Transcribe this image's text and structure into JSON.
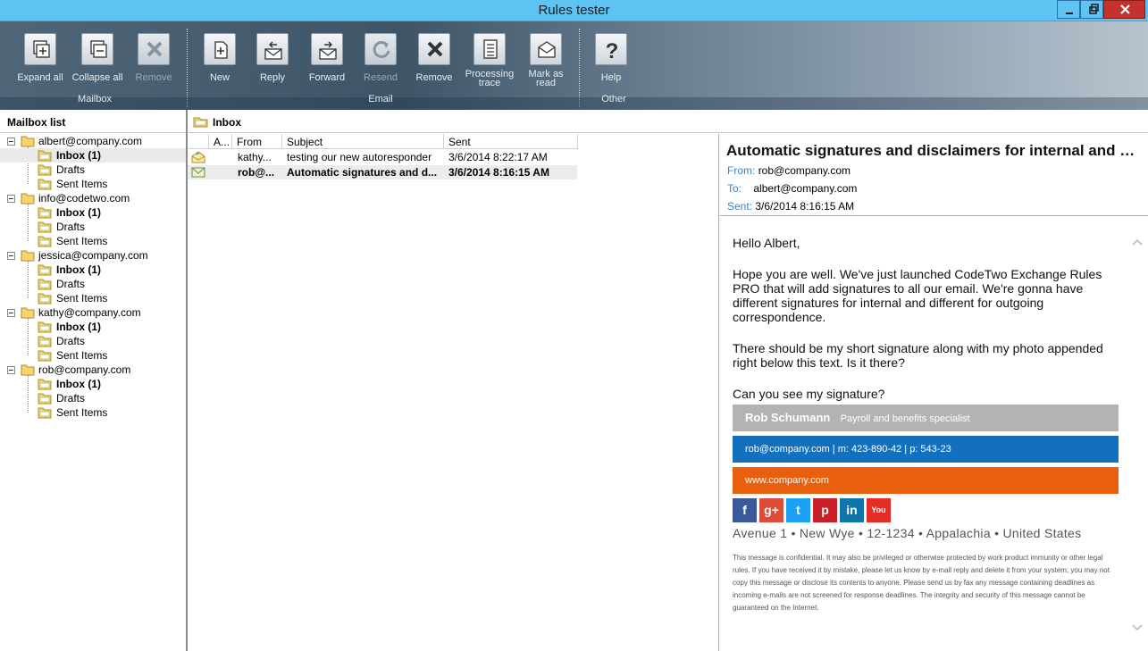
{
  "window": {
    "title": "Rules tester"
  },
  "ribbon": {
    "groups": [
      {
        "label": "Mailbox",
        "buttons": [
          {
            "label": "Expand all",
            "icon": "expand-all-icon",
            "enabled": true
          },
          {
            "label": "Collapse all",
            "icon": "collapse-all-icon",
            "enabled": true
          },
          {
            "label": "Remove",
            "icon": "remove-icon",
            "enabled": false
          }
        ]
      },
      {
        "label": "Email",
        "buttons": [
          {
            "label": "New",
            "icon": "new-email-icon",
            "enabled": true
          },
          {
            "label": "Reply",
            "icon": "reply-icon",
            "enabled": true
          },
          {
            "label": "Forward",
            "icon": "forward-icon",
            "enabled": true
          },
          {
            "label": "Resend",
            "icon": "resend-icon",
            "enabled": false
          },
          {
            "label": "Remove",
            "icon": "remove-icon",
            "enabled": true
          },
          {
            "label": "Processing trace",
            "label_lines": [
              "Processing",
              "trace"
            ],
            "icon": "processing-trace-icon",
            "enabled": true
          },
          {
            "label": "Mark as read",
            "label_lines": [
              "Mark as",
              "read"
            ],
            "icon": "mark-read-icon",
            "enabled": true
          }
        ]
      },
      {
        "label": "Other",
        "buttons": [
          {
            "label": "Help",
            "icon": "help-icon",
            "enabled": true
          }
        ]
      }
    ]
  },
  "mailbox_list": {
    "header": "Mailbox list",
    "accounts": [
      {
        "name": "albert@company.com",
        "folders": [
          "Inbox (1)",
          "Drafts",
          "Sent Items"
        ]
      },
      {
        "name": "info@codetwo.com",
        "folders": [
          "Inbox (1)",
          "Drafts",
          "Sent Items"
        ]
      },
      {
        "name": "jessica@company.com",
        "folders": [
          "Inbox (1)",
          "Drafts",
          "Sent Items"
        ]
      },
      {
        "name": "kathy@company.com",
        "folders": [
          "Inbox (1)",
          "Drafts",
          "Sent Items"
        ]
      },
      {
        "name": "rob@company.com",
        "folders": [
          "Inbox (1)",
          "Drafts",
          "Sent Items"
        ]
      }
    ]
  },
  "inbox": {
    "header": "Inbox",
    "columns": [
      "A...",
      "From",
      "Subject",
      "Sent"
    ],
    "messages": [
      {
        "from": "kathy...",
        "subject": "testing our new autoresponder",
        "sent": "3/6/2014 8:22:17 AM",
        "read": true
      },
      {
        "from": "rob@...",
        "subject": "Automatic signatures and d...",
        "sent": "3/6/2014 8:16:15 AM",
        "read": false
      }
    ]
  },
  "preview": {
    "subject": "Automatic signatures and disclaimers for internal and outgoing correspondence",
    "from_label": "From:",
    "from": "rob@company.com",
    "to_label": "To:",
    "to": "albert@company.com",
    "sent_label": "Sent:",
    "sent": "3/6/2014 8:16:15 AM",
    "body": [
      "Hello Albert,",
      "Hope you are well. We've just launched CodeTwo Exchange Rules PRO that will add signatures to all our email. We're gonna have different signatures for internal and different for outgoing correspondence.",
      "There should be my short signature along with my photo appended right below this text. Is it there?",
      "Can you see my signature?"
    ],
    "signature": {
      "name": "Rob Schumann",
      "title": "Payroll and benefits specialist",
      "contact": "rob@company.com |  m:  423-890-42 | p: 543-23",
      "website": "www.company.com",
      "address": "Avenue 1 • New Wye  • 12-1234 • Appalachia • United States",
      "colors": {
        "name_bar": "#b3b3b3",
        "contact_bar": "#1270bd",
        "web_bar": "#e8600e"
      },
      "social": [
        {
          "name": "facebook-icon",
          "glyph": "f",
          "color": "#3b5998"
        },
        {
          "name": "google-plus-icon",
          "glyph": "g+",
          "color": "#dd4b39"
        },
        {
          "name": "twitter-icon",
          "glyph": "t",
          "color": "#1da1f2"
        },
        {
          "name": "pinterest-icon",
          "glyph": "p",
          "color": "#cb2027"
        },
        {
          "name": "linkedin-icon",
          "glyph": "in",
          "color": "#0e76a8"
        },
        {
          "name": "youtube-icon",
          "glyph": "You",
          "color": "#e52d27"
        }
      ]
    },
    "disclaimer": "This message is confidential. It may also be privileged or otherwise protected by work product immunity or other legal rules. If you have received it by mistake, please let us know by e-mail reply and delete it from your system; you may not copy this message or disclose its contents to anyone. Please send us by fax any message containing deadlines as incoming e-mails are not screened for response deadlines. The integrity and security of this message cannot be guaranteed on the Internet."
  }
}
